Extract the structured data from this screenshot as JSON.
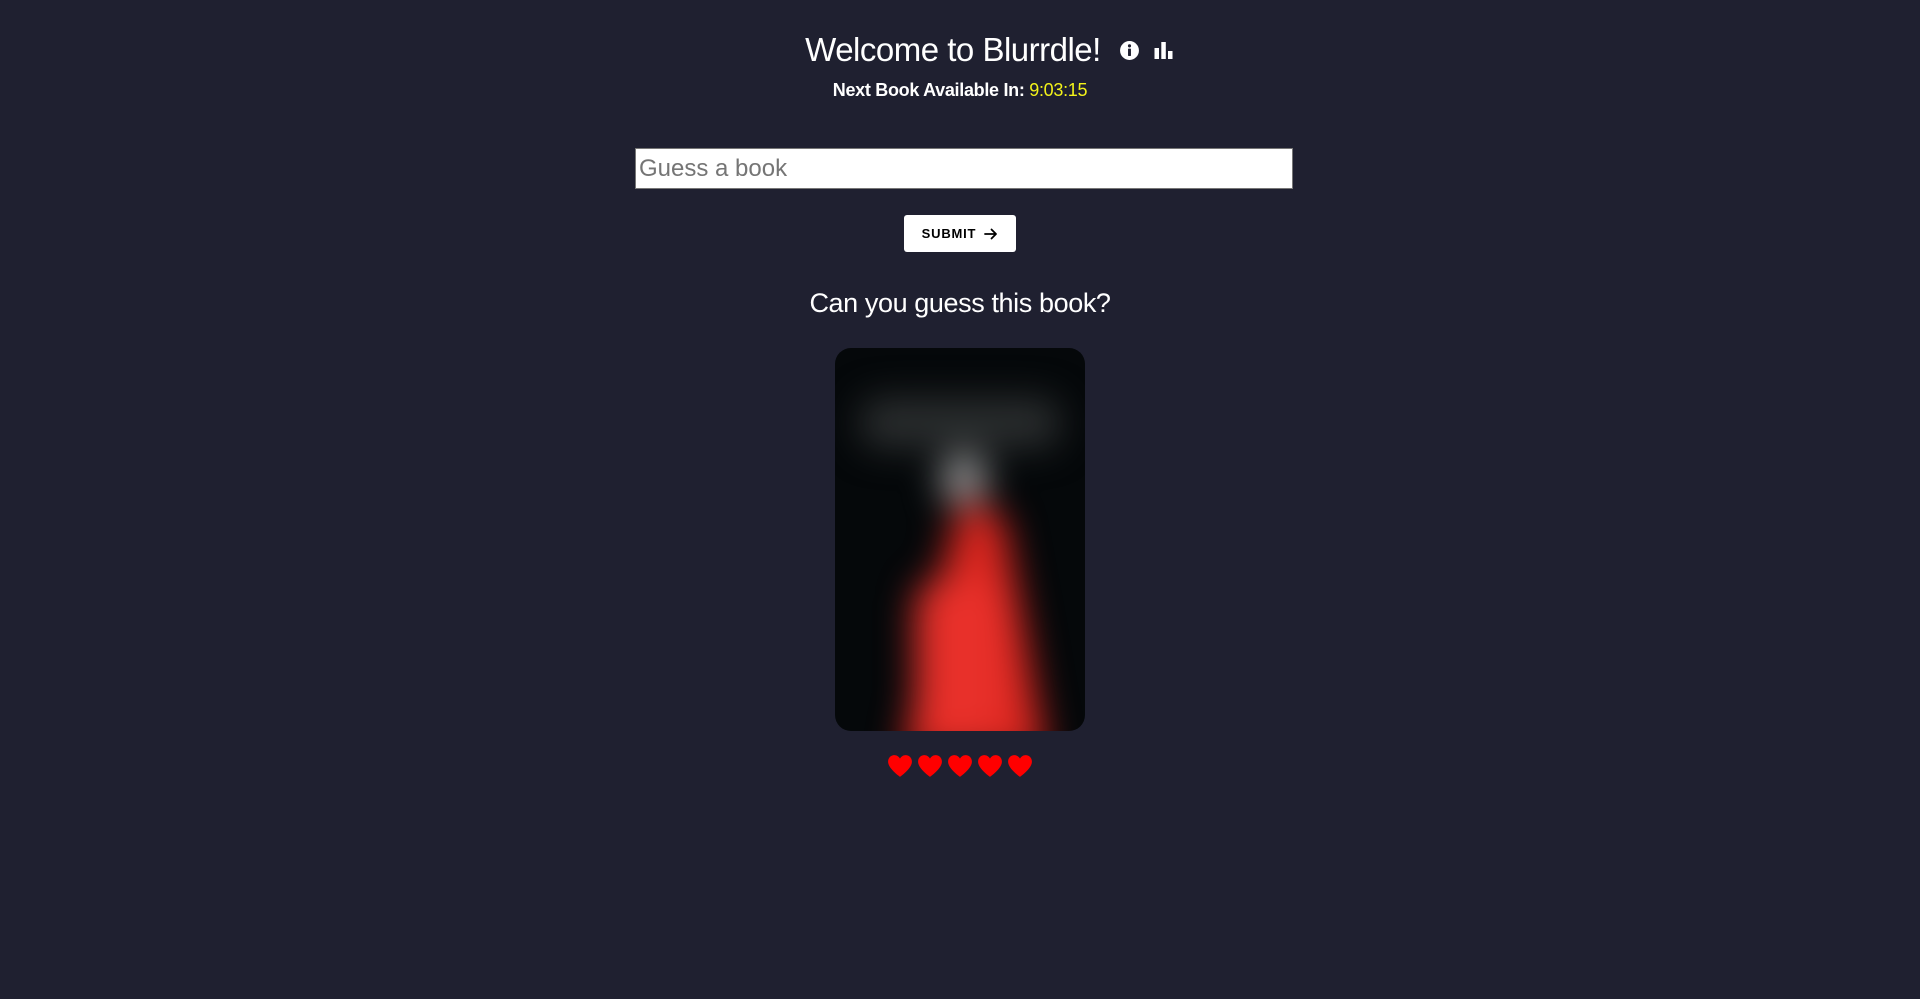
{
  "header": {
    "title": "Welcome to Blurrdle!",
    "icons": [
      "info-icon",
      "stats-bar-chart-icon"
    ]
  },
  "countdown": {
    "label": "Next Book Available In:",
    "time": "9:03:15",
    "time_color": "#f2f21a"
  },
  "guess": {
    "placeholder": "Guess a book",
    "value": ""
  },
  "submit": {
    "label": "SUBMIT",
    "icon": "arrow-right-icon"
  },
  "prompt": {
    "text": "Can you guess this book?"
  },
  "lives": {
    "remaining": 5,
    "total": 5,
    "icon": "heart-icon",
    "color": "#ff0000"
  },
  "colors": {
    "background": "#1f2030",
    "accent": "#f2f21a",
    "heart": "#ff0000"
  }
}
